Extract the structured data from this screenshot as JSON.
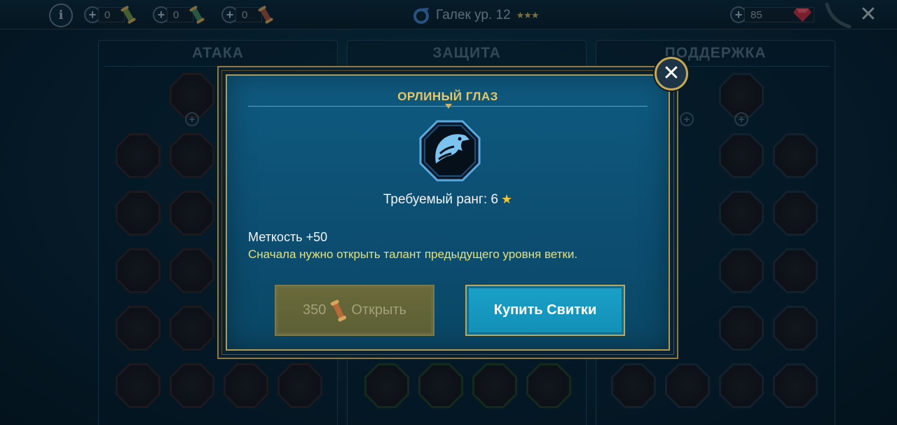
{
  "topbar": {
    "info_label": "i",
    "resources": [
      {
        "name": "green-scroll",
        "amount": "0",
        "color": "#6c8a3c"
      },
      {
        "name": "teal-scroll",
        "amount": "0",
        "color": "#3f7f5a"
      },
      {
        "name": "red-scroll",
        "amount": "0",
        "color": "#9a4a3a"
      }
    ],
    "hero_title": "Галек ур. 12",
    "hero_stars": "★★★",
    "gems": "85",
    "close_label": "✕"
  },
  "columns": [
    {
      "title": "АТАКА"
    },
    {
      "title": "ЗАЩИТА"
    },
    {
      "title": "ПОДДЕРЖКА"
    }
  ],
  "modal": {
    "title": "ОРЛИНЫЙ ГЛАЗ",
    "rank_label": "Требуемый ранг: 6",
    "rank_star": "★",
    "bonus": "Меткость +50",
    "warning": "Сначала нужно открыть талант предыдущего уровня ветки.",
    "open_cost": "350",
    "open_label": "Открыть",
    "buy_label": "Купить Свитки",
    "close_label": "✕"
  },
  "colors": {
    "accent_gold": "#e6c968",
    "warning_yellow": "#e8e070",
    "buy_button": "#1aa1c9",
    "modal_bg": "#0f5a80"
  }
}
